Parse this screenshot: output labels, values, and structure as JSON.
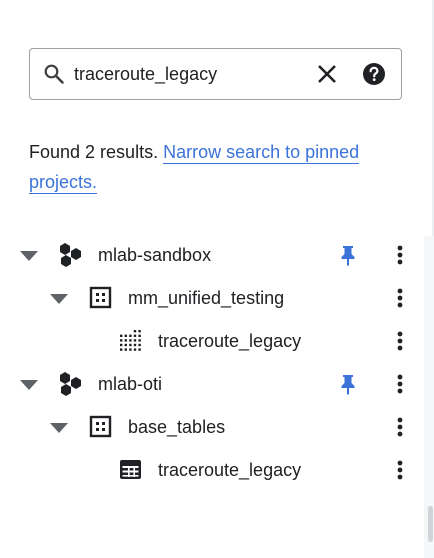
{
  "search": {
    "value": "traceroute_legacy",
    "icon": "search-icon",
    "clear_icon": "close-icon",
    "help_icon": "help-icon"
  },
  "results": {
    "summary": "Found 2 results.",
    "link": "Narrow search to pinned projects."
  },
  "tree": [
    {
      "level": 0,
      "type": "project",
      "label": "mlab-sandbox",
      "pinned": true
    },
    {
      "level": 1,
      "type": "dataset",
      "label": "mm_unified_testing",
      "pinned": false
    },
    {
      "level": 2,
      "type": "view",
      "label": "traceroute_legacy",
      "pinned": false
    },
    {
      "level": 0,
      "type": "project",
      "label": "mlab-oti",
      "pinned": true
    },
    {
      "level": 1,
      "type": "dataset",
      "label": "base_tables",
      "pinned": false
    },
    {
      "level": 2,
      "type": "table",
      "label": "traceroute_legacy",
      "pinned": false
    }
  ],
  "colors": {
    "link": "#3b73d9",
    "pin": "#3b73d9",
    "text": "#202124",
    "icon": "#202124"
  }
}
